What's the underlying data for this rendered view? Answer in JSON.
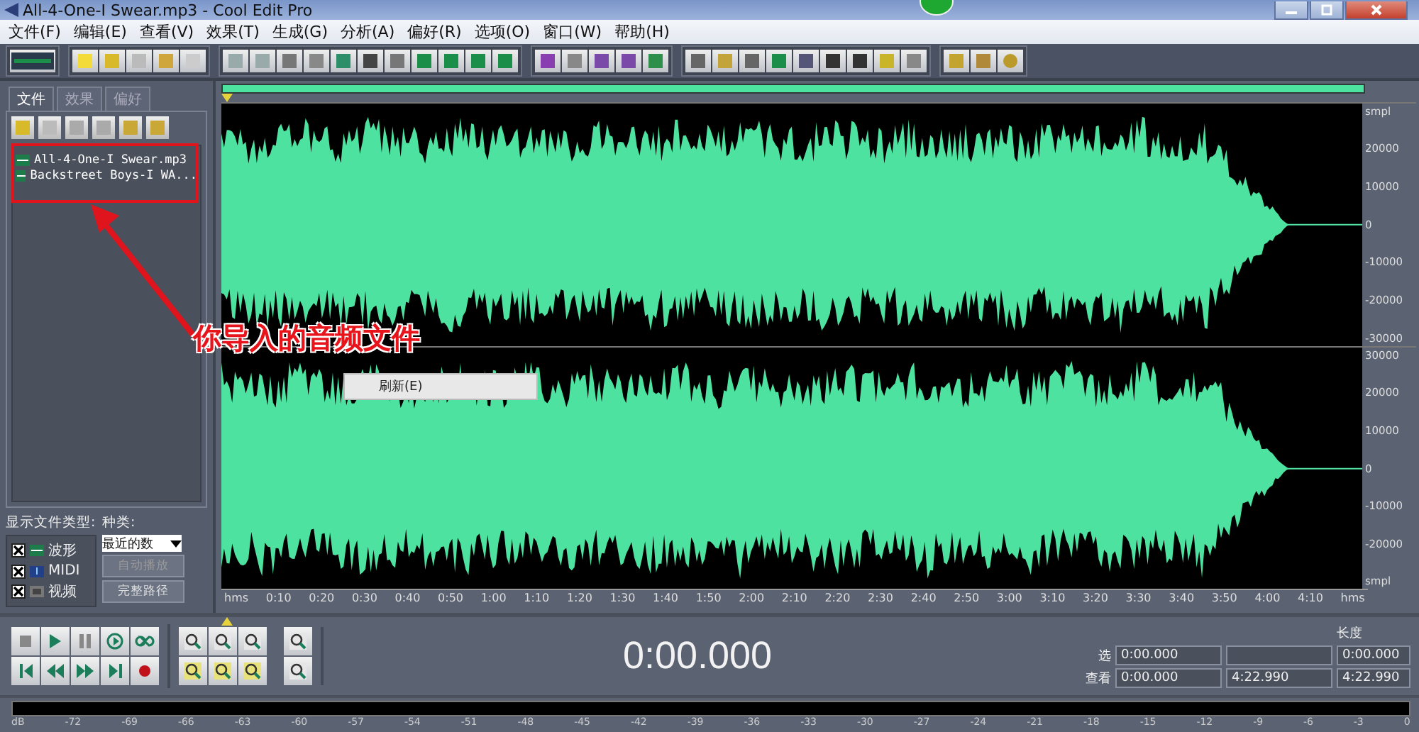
{
  "window": {
    "title": "All-4-One-I Swear.mp3 - Cool Edit Pro"
  },
  "menu": [
    "文件(F)",
    "编辑(E)",
    "查看(V)",
    "效果(T)",
    "生成(G)",
    "分析(A)",
    "偏好(R)",
    "选项(O)",
    "窗口(W)",
    "帮助(H)"
  ],
  "left_panel": {
    "tabs": [
      {
        "label": "文件",
        "selected": true
      },
      {
        "label": "效果",
        "selected": false
      },
      {
        "label": "偏好",
        "selected": false
      }
    ],
    "files": [
      {
        "name": "All-4-One-I Swear.mp3"
      },
      {
        "name": "Backstreet Boys-I WA..."
      }
    ],
    "filter_label": "显示文件类型:",
    "file_types": [
      {
        "label": "波形",
        "kind": "wave",
        "checked": true
      },
      {
        "label": "MIDI",
        "kind": "midi",
        "checked": true
      },
      {
        "label": "视频",
        "kind": "video",
        "checked": true
      }
    ],
    "sort_label": "种类:",
    "sort_value": "最近的数",
    "buttons": [
      {
        "label": "自动播放",
        "disabled": true
      },
      {
        "label": "完整路径",
        "disabled": false
      }
    ]
  },
  "annotation": {
    "text": "你导入的音频文件"
  },
  "waveform": {
    "channels": [
      {
        "labels": [
          "smpl",
          "20000",
          "10000",
          "0",
          "-10000",
          "-20000",
          "-30000"
        ]
      },
      {
        "labels": [
          "30000",
          "20000",
          "10000",
          "0",
          "-10000",
          "-20000",
          "smpl"
        ]
      }
    ],
    "time_labels": [
      "hms",
      "0:10",
      "0:20",
      "0:30",
      "0:40",
      "0:50",
      "1:00",
      "1:10",
      "1:20",
      "1:30",
      "1:40",
      "1:50",
      "2:00",
      "2:10",
      "2:20",
      "2:30",
      "2:40",
      "2:50",
      "3:00",
      "3:10",
      "3:20",
      "3:30",
      "3:40",
      "3:50",
      "4:00",
      "4:10",
      "hms"
    ]
  },
  "context_menu": {
    "items": [
      "刷新(E)"
    ]
  },
  "transport": {
    "time": "0:00.000"
  },
  "selection": {
    "length_label": "长度",
    "rows": [
      {
        "label": "选",
        "begin": "0:00.000",
        "length": "0:00.000"
      },
      {
        "label": "查看",
        "begin": "0:00.000",
        "end": "4:22.990",
        "length": "4:22.990"
      }
    ]
  },
  "level_meter": {
    "labels": [
      "dB",
      "-72",
      "-69",
      "-66",
      "-63",
      "-60",
      "-57",
      "-54",
      "-51",
      "-48",
      "-45",
      "-42",
      "-39",
      "-36",
      "-33",
      "-30",
      "-27",
      "-24",
      "-21",
      "-18",
      "-15",
      "-12",
      "-9",
      "-6",
      "-3",
      "0"
    ]
  }
}
